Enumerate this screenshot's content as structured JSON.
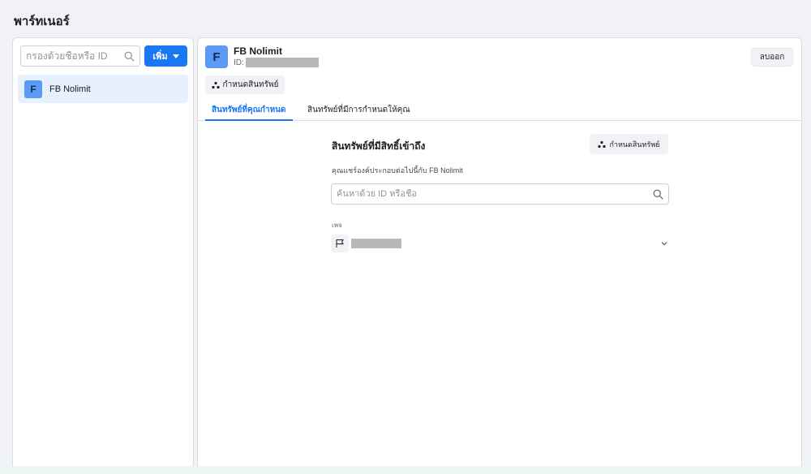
{
  "header": {
    "title": "พาร์ทเนอร์"
  },
  "sidebar": {
    "filter_placeholder": "กรองด้วยชื่อหรือ ID",
    "add_label": "เพิ่ม",
    "partners": [
      {
        "initial": "F",
        "name": "FB Nolimit"
      }
    ]
  },
  "partner": {
    "initial": "F",
    "name": "FB Nolimit",
    "id_label": "ID:",
    "remove_label": "ลบออก",
    "assign_label": "กำหนดสินทรัพย์"
  },
  "tabs": [
    {
      "label": "สินทรัพย์ที่คุณกำหนด",
      "active": true
    },
    {
      "label": "สินทรัพย์ที่มีการกำหนดให้คุณ",
      "active": false
    }
  ],
  "assets": {
    "title": "สินทรัพย์ที่มีสิทธิ์เข้าถึง",
    "assign_label": "กำหนดสินทรัพย์",
    "description": "คุณแชร์องค์ประกอบต่อไปนี้กับ FB Nolimit",
    "search_placeholder": "ค้นหาด้วย ID หรือชื่อ",
    "group_label": "เพจ"
  },
  "colors": {
    "accent": "#1877f2",
    "avatar": "#5b9bf5",
    "selected_bg": "#e7f0fd"
  },
  "icons": {
    "search": "search-icon",
    "people": "people-icon",
    "flag": "flag-icon",
    "chevron": "chevron-down-icon"
  }
}
